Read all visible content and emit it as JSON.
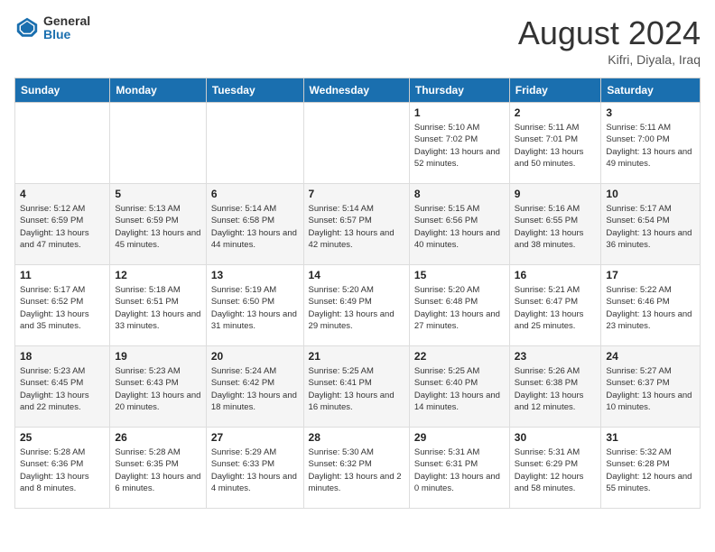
{
  "header": {
    "logo_general": "General",
    "logo_blue": "Blue",
    "month_year": "August 2024",
    "location": "Kifri, Diyala, Iraq"
  },
  "days_of_week": [
    "Sunday",
    "Monday",
    "Tuesday",
    "Wednesday",
    "Thursday",
    "Friday",
    "Saturday"
  ],
  "weeks": [
    [
      {
        "day": "",
        "sunrise": "",
        "sunset": "",
        "daylight": ""
      },
      {
        "day": "",
        "sunrise": "",
        "sunset": "",
        "daylight": ""
      },
      {
        "day": "",
        "sunrise": "",
        "sunset": "",
        "daylight": ""
      },
      {
        "day": "",
        "sunrise": "",
        "sunset": "",
        "daylight": ""
      },
      {
        "day": "1",
        "sunrise": "Sunrise: 5:10 AM",
        "sunset": "Sunset: 7:02 PM",
        "daylight": "Daylight: 13 hours and 52 minutes."
      },
      {
        "day": "2",
        "sunrise": "Sunrise: 5:11 AM",
        "sunset": "Sunset: 7:01 PM",
        "daylight": "Daylight: 13 hours and 50 minutes."
      },
      {
        "day": "3",
        "sunrise": "Sunrise: 5:11 AM",
        "sunset": "Sunset: 7:00 PM",
        "daylight": "Daylight: 13 hours and 49 minutes."
      }
    ],
    [
      {
        "day": "4",
        "sunrise": "Sunrise: 5:12 AM",
        "sunset": "Sunset: 6:59 PM",
        "daylight": "Daylight: 13 hours and 47 minutes."
      },
      {
        "day": "5",
        "sunrise": "Sunrise: 5:13 AM",
        "sunset": "Sunset: 6:59 PM",
        "daylight": "Daylight: 13 hours and 45 minutes."
      },
      {
        "day": "6",
        "sunrise": "Sunrise: 5:14 AM",
        "sunset": "Sunset: 6:58 PM",
        "daylight": "Daylight: 13 hours and 44 minutes."
      },
      {
        "day": "7",
        "sunrise": "Sunrise: 5:14 AM",
        "sunset": "Sunset: 6:57 PM",
        "daylight": "Daylight: 13 hours and 42 minutes."
      },
      {
        "day": "8",
        "sunrise": "Sunrise: 5:15 AM",
        "sunset": "Sunset: 6:56 PM",
        "daylight": "Daylight: 13 hours and 40 minutes."
      },
      {
        "day": "9",
        "sunrise": "Sunrise: 5:16 AM",
        "sunset": "Sunset: 6:55 PM",
        "daylight": "Daylight: 13 hours and 38 minutes."
      },
      {
        "day": "10",
        "sunrise": "Sunrise: 5:17 AM",
        "sunset": "Sunset: 6:54 PM",
        "daylight": "Daylight: 13 hours and 36 minutes."
      }
    ],
    [
      {
        "day": "11",
        "sunrise": "Sunrise: 5:17 AM",
        "sunset": "Sunset: 6:52 PM",
        "daylight": "Daylight: 13 hours and 35 minutes."
      },
      {
        "day": "12",
        "sunrise": "Sunrise: 5:18 AM",
        "sunset": "Sunset: 6:51 PM",
        "daylight": "Daylight: 13 hours and 33 minutes."
      },
      {
        "day": "13",
        "sunrise": "Sunrise: 5:19 AM",
        "sunset": "Sunset: 6:50 PM",
        "daylight": "Daylight: 13 hours and 31 minutes."
      },
      {
        "day": "14",
        "sunrise": "Sunrise: 5:20 AM",
        "sunset": "Sunset: 6:49 PM",
        "daylight": "Daylight: 13 hours and 29 minutes."
      },
      {
        "day": "15",
        "sunrise": "Sunrise: 5:20 AM",
        "sunset": "Sunset: 6:48 PM",
        "daylight": "Daylight: 13 hours and 27 minutes."
      },
      {
        "day": "16",
        "sunrise": "Sunrise: 5:21 AM",
        "sunset": "Sunset: 6:47 PM",
        "daylight": "Daylight: 13 hours and 25 minutes."
      },
      {
        "day": "17",
        "sunrise": "Sunrise: 5:22 AM",
        "sunset": "Sunset: 6:46 PM",
        "daylight": "Daylight: 13 hours and 23 minutes."
      }
    ],
    [
      {
        "day": "18",
        "sunrise": "Sunrise: 5:23 AM",
        "sunset": "Sunset: 6:45 PM",
        "daylight": "Daylight: 13 hours and 22 minutes."
      },
      {
        "day": "19",
        "sunrise": "Sunrise: 5:23 AM",
        "sunset": "Sunset: 6:43 PM",
        "daylight": "Daylight: 13 hours and 20 minutes."
      },
      {
        "day": "20",
        "sunrise": "Sunrise: 5:24 AM",
        "sunset": "Sunset: 6:42 PM",
        "daylight": "Daylight: 13 hours and 18 minutes."
      },
      {
        "day": "21",
        "sunrise": "Sunrise: 5:25 AM",
        "sunset": "Sunset: 6:41 PM",
        "daylight": "Daylight: 13 hours and 16 minutes."
      },
      {
        "day": "22",
        "sunrise": "Sunrise: 5:25 AM",
        "sunset": "Sunset: 6:40 PM",
        "daylight": "Daylight: 13 hours and 14 minutes."
      },
      {
        "day": "23",
        "sunrise": "Sunrise: 5:26 AM",
        "sunset": "Sunset: 6:38 PM",
        "daylight": "Daylight: 13 hours and 12 minutes."
      },
      {
        "day": "24",
        "sunrise": "Sunrise: 5:27 AM",
        "sunset": "Sunset: 6:37 PM",
        "daylight": "Daylight: 13 hours and 10 minutes."
      }
    ],
    [
      {
        "day": "25",
        "sunrise": "Sunrise: 5:28 AM",
        "sunset": "Sunset: 6:36 PM",
        "daylight": "Daylight: 13 hours and 8 minutes."
      },
      {
        "day": "26",
        "sunrise": "Sunrise: 5:28 AM",
        "sunset": "Sunset: 6:35 PM",
        "daylight": "Daylight: 13 hours and 6 minutes."
      },
      {
        "day": "27",
        "sunrise": "Sunrise: 5:29 AM",
        "sunset": "Sunset: 6:33 PM",
        "daylight": "Daylight: 13 hours and 4 minutes."
      },
      {
        "day": "28",
        "sunrise": "Sunrise: 5:30 AM",
        "sunset": "Sunset: 6:32 PM",
        "daylight": "Daylight: 13 hours and 2 minutes."
      },
      {
        "day": "29",
        "sunrise": "Sunrise: 5:31 AM",
        "sunset": "Sunset: 6:31 PM",
        "daylight": "Daylight: 13 hours and 0 minutes."
      },
      {
        "day": "30",
        "sunrise": "Sunrise: 5:31 AM",
        "sunset": "Sunset: 6:29 PM",
        "daylight": "Daylight: 12 hours and 58 minutes."
      },
      {
        "day": "31",
        "sunrise": "Sunrise: 5:32 AM",
        "sunset": "Sunset: 6:28 PM",
        "daylight": "Daylight: 12 hours and 55 minutes."
      }
    ]
  ]
}
